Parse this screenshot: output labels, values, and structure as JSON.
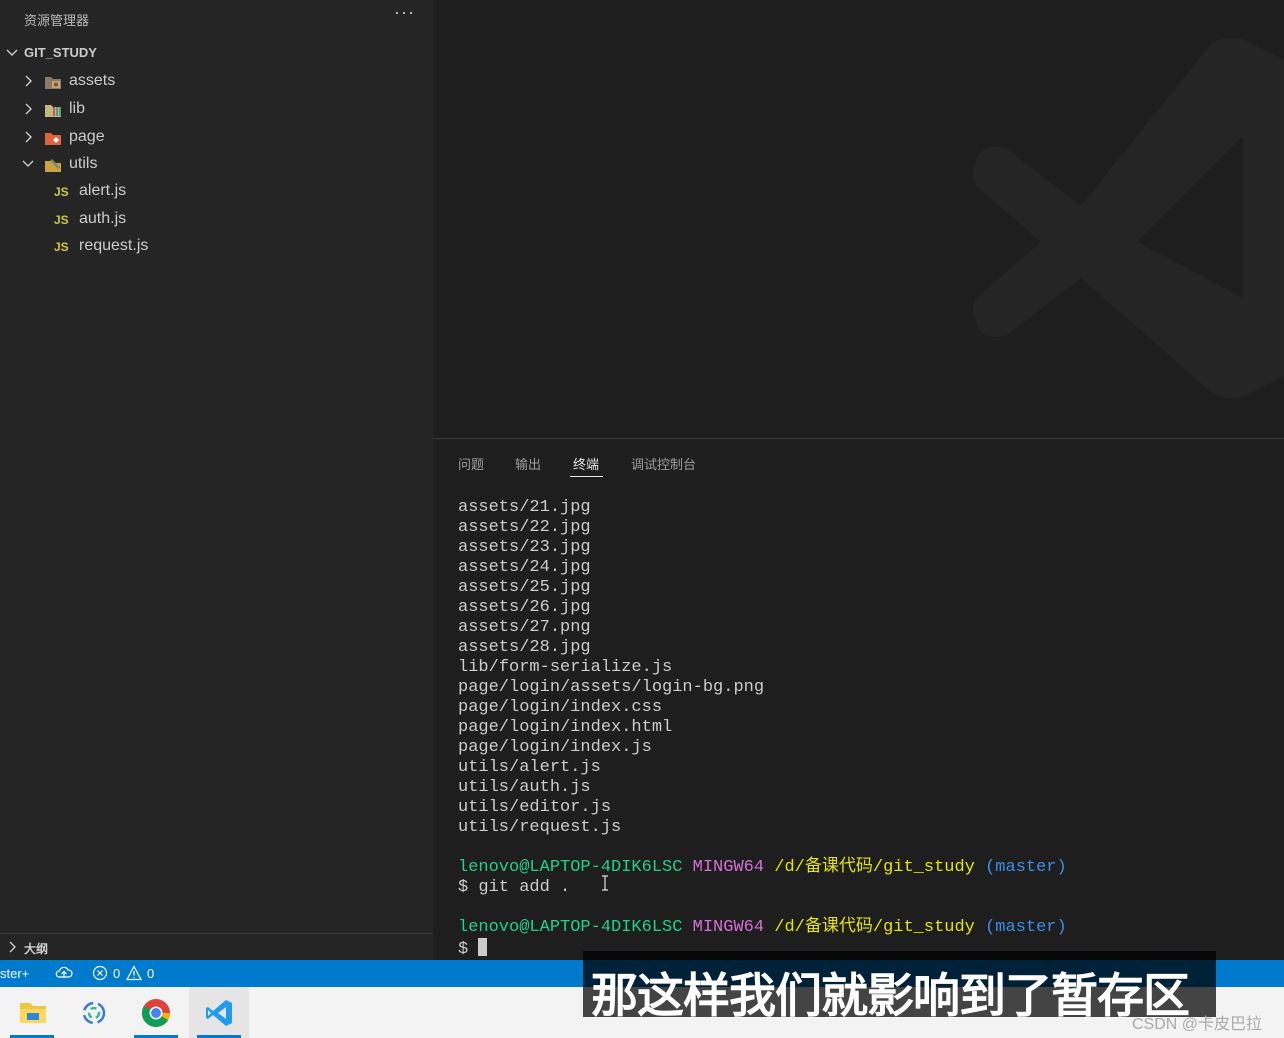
{
  "sidebar": {
    "title": "资源管理器",
    "more": "···",
    "root": "GIT_STUDY",
    "items": [
      {
        "label": "assets",
        "type": "folder"
      },
      {
        "label": "lib",
        "type": "folder"
      },
      {
        "label": "page",
        "type": "folder"
      },
      {
        "label": "utils",
        "type": "folder"
      },
      {
        "label": "alert.js",
        "type": "js"
      },
      {
        "label": "auth.js",
        "type": "js"
      },
      {
        "label": "request.js",
        "type": "js"
      }
    ],
    "js_badge": "JS",
    "outline": "大纲"
  },
  "panel": {
    "tabs": [
      "问题",
      "输出",
      "终端",
      "调试控制台"
    ],
    "active_tab": "终端"
  },
  "terminal": {
    "files": [
      "assets/21.jpg",
      "assets/22.jpg",
      "assets/23.jpg",
      "assets/24.jpg",
      "assets/25.jpg",
      "assets/26.jpg",
      "assets/27.png",
      "assets/28.jpg",
      "lib/form-serialize.js",
      "page/login/assets/login-bg.png",
      "page/login/index.css",
      "page/login/index.html",
      "page/login/index.js",
      "utils/alert.js",
      "utils/auth.js",
      "utils/editor.js",
      "utils/request.js"
    ],
    "prompt_user": "lenovo@LAPTOP-4DIK6LSC",
    "prompt_env": "MINGW64",
    "prompt_path": "/d/备课代码/git_study",
    "prompt_branch": "(master)",
    "command": "$ git add .",
    "prompt_symbol": "$"
  },
  "statusbar": {
    "branch": "ster+",
    "errors": "0",
    "warnings": "0"
  },
  "subtitle": "那这样我们就影响到了暂存区",
  "watermark": "CSDN @卡皮巴拉",
  "colors": {
    "statusbar": "#007acc",
    "sidebar": "#252526",
    "editor": "#1e1e1e",
    "js": "#cbcb41"
  }
}
